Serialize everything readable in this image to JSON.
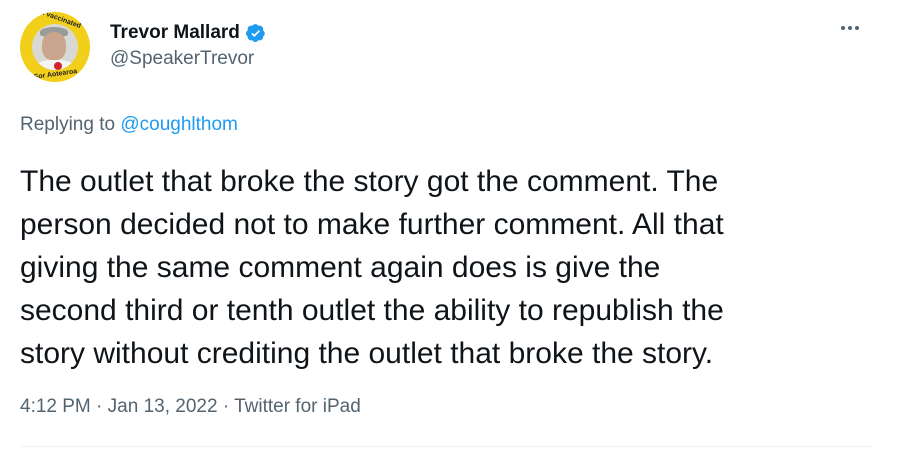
{
  "tweet": {
    "author": {
      "name": "Trevor Mallard",
      "handle": "@SpeakerTrevor",
      "verified": true,
      "avatar": {
        "icon": "profile-photo",
        "ring_top": "I'm vaccinated",
        "ring_bottom": "For Aotearoa"
      }
    },
    "menu_icon": "more-icon",
    "reply": {
      "prefix": "Replying to",
      "mention": "@coughlthom"
    },
    "text_lines": [
      "The outlet that broke the story got the comment. The",
      "person decided not to make further comment. All that",
      "giving the same comment again does is give the",
      "second third or tenth outlet the ability to republish the",
      "story without crediting the outlet that broke the story."
    ],
    "meta": {
      "time": "4:12 PM",
      "separator": "·",
      "date": "Jan 13, 2022",
      "source": "Twitter for iPad"
    },
    "colors": {
      "text": "#0f1419",
      "secondary": "#536471",
      "link": "#1d9bf0",
      "verified": "#1d9bf0",
      "avatar_ring": "#f2cf1b"
    }
  }
}
